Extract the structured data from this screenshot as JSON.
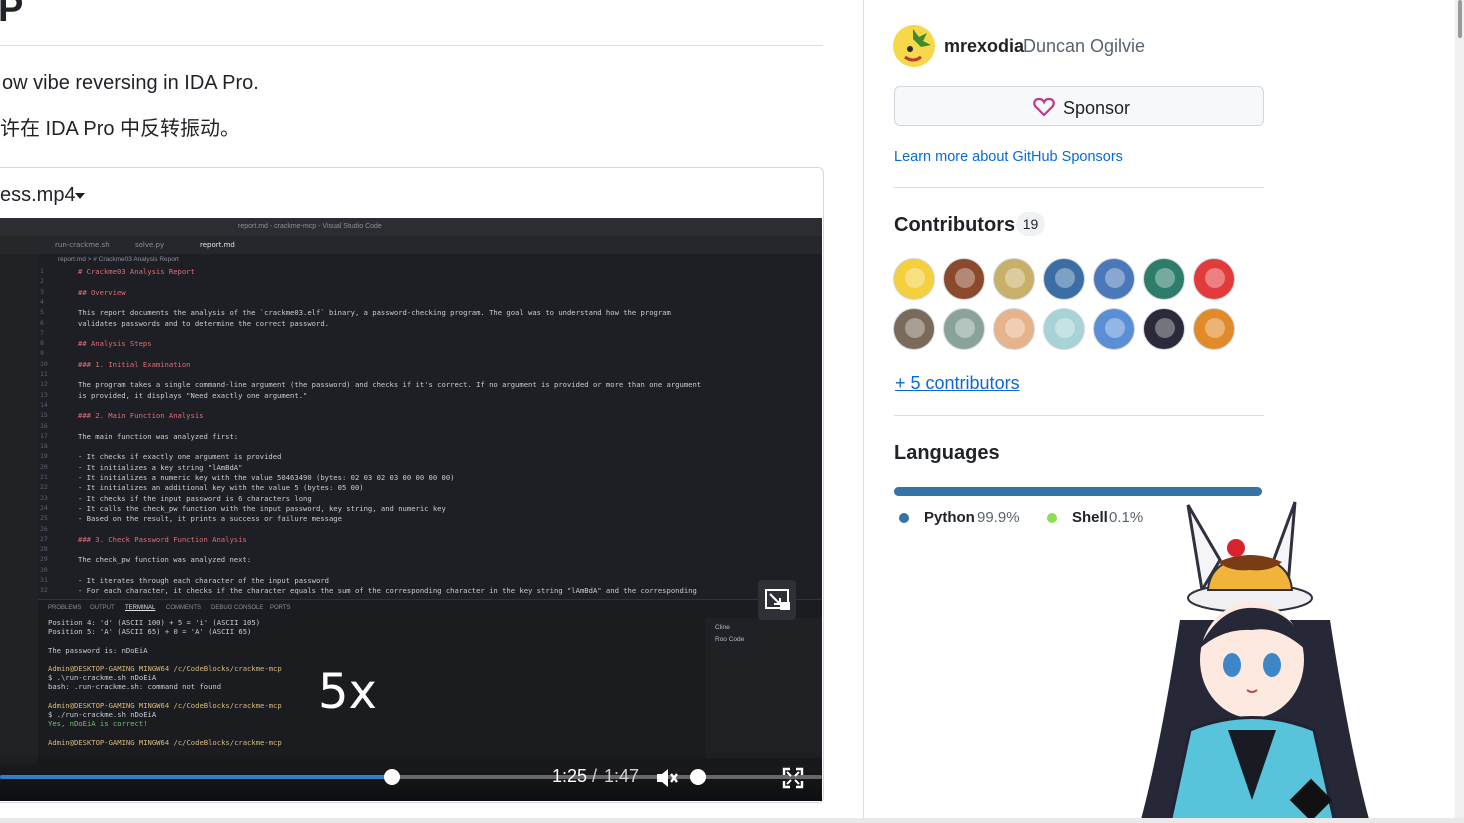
{
  "readme": {
    "title_fragment": "P",
    "description_en": "ow vibe reversing in IDA Pro.",
    "description_zh": "许在 IDA Pro 中反转振动。",
    "video_filename": "ess.mp4"
  },
  "video": {
    "window_title": "report.md - crackme-mcp - Visual Studio Code",
    "tabs": [
      "run-crackme.sh",
      "solve.py",
      "report.md"
    ],
    "breadcrumb": "report.md > # Crackme03 Analysis Report",
    "editor_lines": [
      "# Crackme03 Analysis Report",
      "",
      "## Overview",
      "",
      "This report documents the analysis of the `crackme03.elf` binary, a password-checking program. The goal was to understand how the program",
      "validates passwords and to determine the correct password.",
      "",
      "## Analysis Steps",
      "",
      "### 1. Initial Examination",
      "",
      "The program takes a single command-line argument (the password) and checks if it's correct. If no argument is provided or more than one argument",
      "is provided, it displays \"Need exactly one argument.\"",
      "",
      "### 2. Main Function Analysis",
      "",
      "The main function was analyzed first:",
      "",
      "- It checks if exactly one argument is provided",
      "- It initializes a key string \"lAmBdA\"",
      "- It initializes a numeric key with the value 50463490 (bytes: 02 03 02 03 00 00 00 00)",
      "- It initializes an additional key with the value 5 (bytes: 05 00)",
      "- It checks if the input password is 6 characters long",
      "- It calls the check_pw function with the input password, key string, and numeric key",
      "- Based on the result, it prints a success or failure message",
      "",
      "### 3. Check Password Function Analysis",
      "",
      "The check_pw function was analyzed next:",
      "",
      "- It iterates through each character of the input password",
      "- For each character, it checks if the character equals the sum of the corresponding character in the key string \"lAmBdA\" and the corresponding"
    ],
    "panel_tabs": [
      "PROBLEMS",
      "OUTPUT",
      "TERMINAL",
      "COMMENTS",
      "DEBUG CONSOLE",
      "PORTS"
    ],
    "terminal_lines": [
      "Position 4: 'd' (ASCII 100) + 5 = 'i' (ASCII 105)",
      "Position 5: 'A' (ASCII 65) + 0 = 'A' (ASCII 65)",
      "",
      "The password is: nDoEiA",
      "",
      "Admin@DESKTOP-GAMING MINGW64 /c/CodeBlocks/crackme-mcp",
      "$ .\\run-crackme.sh nDoEiA",
      "bash: .run-crackme.sh: command not found",
      "",
      "Admin@DESKTOP-GAMING MINGW64 /c/CodeBlocks/crackme-mcp",
      "$ ./run-crackme.sh nDoEiA",
      "Yes, nDoEiA is correct!",
      "",
      "Admin@DESKTOP-GAMING MINGW64 /c/CodeBlocks/crackme-mcp"
    ],
    "side_panel_items": [
      "Cline",
      "Roo Code"
    ],
    "speed_overlay": "5x",
    "time_current": "1:25",
    "time_separator": "/",
    "time_total": "1:47",
    "progress": 0.794,
    "volume": 0.0
  },
  "sidebar": {
    "sponsor": {
      "login": "mrexodia",
      "name": "Duncan Ogilvie",
      "button_label": "Sponsor",
      "learn_more": "Learn more about GitHub Sponsors"
    },
    "contributors": {
      "title": "Contributors",
      "count": "19",
      "avatar_colors": [
        "#f4d03f",
        "#8b4a2b",
        "#c9b06a",
        "#3a6ea5",
        "#4a78b8",
        "#2e7d6b",
        "#e23b3b",
        "#7a6a5a",
        "#8aa39a",
        "#e6b48a",
        "#a7d3d6",
        "#5a8fd6",
        "#2a2a3a",
        "#e08a2a"
      ],
      "more_link": "+ 5 contributors"
    },
    "languages": {
      "title": "Languages",
      "items": [
        {
          "name": "Python",
          "percent": "99.9%",
          "value": 99.9,
          "color": "#3572A5"
        },
        {
          "name": "Shell",
          "percent": "0.1%",
          "value": 0.1,
          "color": "#89e051"
        }
      ]
    }
  }
}
